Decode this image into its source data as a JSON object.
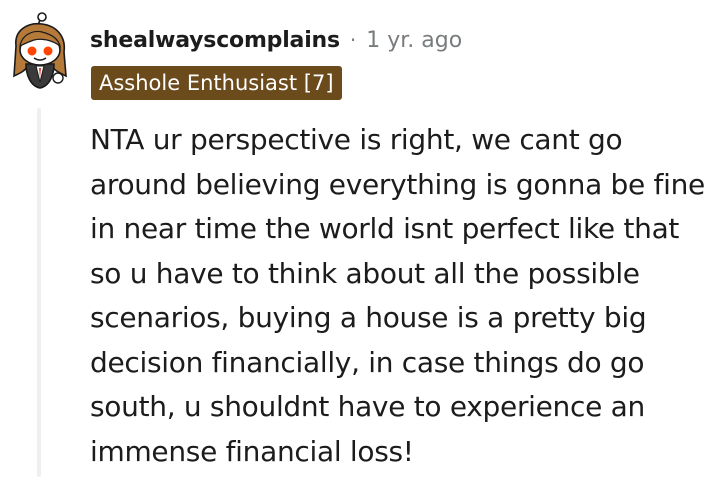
{
  "comment": {
    "author": "shealwayscomplains",
    "separator": "·",
    "timestamp": "1 yr. ago",
    "flair": "Asshole Enthusiast [7]",
    "body": "NTA ur perspective is right, we cant go around believing everything is gonna be fine in near time the world isnt perfect like that so u have to think about all the possible scenarios, buying a house is a pretty big decision financially, in case things do go south, u shouldnt have to experience an immense financial loss!",
    "avatar_icon": "snoo-avatar-icon"
  },
  "colors": {
    "flair_background": "#6b4a1c",
    "flair_text": "#ffffff",
    "meta_text": "#787c7e",
    "thread_line": "#edeff1",
    "avatar_hair": "#b5793a",
    "avatar_eyes": "#ff4500"
  }
}
